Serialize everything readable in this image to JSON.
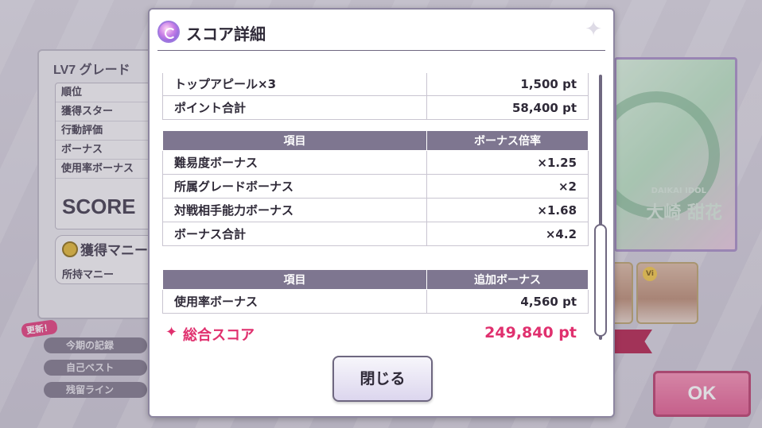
{
  "background": {
    "left_panel": {
      "title": "LV7 グレード",
      "stats": [
        "順位",
        "獲得スター",
        "行動評価",
        "ボーナス",
        "使用率ボーナス"
      ],
      "score_label": "SCORE",
      "money_title": "獲得マニー",
      "money_row": "所持マニー"
    },
    "side_tabs": {
      "new_badge": "更新！",
      "items": [
        "今期の記録",
        "自己ベスト",
        "残留ライン"
      ]
    },
    "card": {
      "sub": "DAIKAI IDOL",
      "name": "大崎 甜花"
    },
    "thumb_badge": "Vi",
    "ok_label": "OK"
  },
  "modal": {
    "title": "スコア詳細",
    "rows_top": [
      {
        "label": "トップアピール×3",
        "value": "1,500 pt"
      },
      {
        "label": "ポイント合計",
        "value": "58,400 pt"
      }
    ],
    "bonus_table": {
      "headers": [
        "項目",
        "ボーナス倍率"
      ],
      "rows": [
        {
          "label": "難易度ボーナス",
          "value": "×1.25"
        },
        {
          "label": "所属グレードボーナス",
          "value": "×2"
        },
        {
          "label": "対戦相手能力ボーナス",
          "value": "×1.68"
        },
        {
          "label": "ボーナス合計",
          "value": "×4.2"
        }
      ]
    },
    "extra_table": {
      "headers": [
        "項目",
        "追加ボーナス"
      ],
      "rows": [
        {
          "label": "使用率ボーナス",
          "value": "4,560 pt"
        }
      ]
    },
    "total": {
      "star": "✦",
      "label": "総合スコア",
      "value": "249,840 pt"
    },
    "close_label": "閉じる"
  }
}
